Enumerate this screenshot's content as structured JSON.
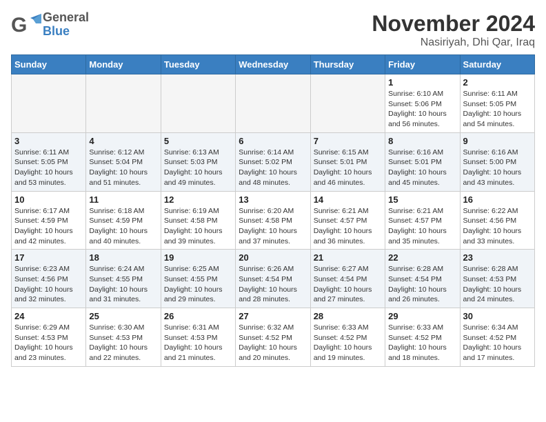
{
  "header": {
    "logo_line1": "General",
    "logo_line2": "Blue",
    "month": "November 2024",
    "location": "Nasiriyah, Dhi Qar, Iraq"
  },
  "days_of_week": [
    "Sunday",
    "Monday",
    "Tuesday",
    "Wednesday",
    "Thursday",
    "Friday",
    "Saturday"
  ],
  "weeks": [
    [
      {
        "day": "",
        "info": ""
      },
      {
        "day": "",
        "info": ""
      },
      {
        "day": "",
        "info": ""
      },
      {
        "day": "",
        "info": ""
      },
      {
        "day": "",
        "info": ""
      },
      {
        "day": "1",
        "info": "Sunrise: 6:10 AM\nSunset: 5:06 PM\nDaylight: 10 hours\nand 56 minutes."
      },
      {
        "day": "2",
        "info": "Sunrise: 6:11 AM\nSunset: 5:05 PM\nDaylight: 10 hours\nand 54 minutes."
      }
    ],
    [
      {
        "day": "3",
        "info": "Sunrise: 6:11 AM\nSunset: 5:05 PM\nDaylight: 10 hours\nand 53 minutes."
      },
      {
        "day": "4",
        "info": "Sunrise: 6:12 AM\nSunset: 5:04 PM\nDaylight: 10 hours\nand 51 minutes."
      },
      {
        "day": "5",
        "info": "Sunrise: 6:13 AM\nSunset: 5:03 PM\nDaylight: 10 hours\nand 49 minutes."
      },
      {
        "day": "6",
        "info": "Sunrise: 6:14 AM\nSunset: 5:02 PM\nDaylight: 10 hours\nand 48 minutes."
      },
      {
        "day": "7",
        "info": "Sunrise: 6:15 AM\nSunset: 5:01 PM\nDaylight: 10 hours\nand 46 minutes."
      },
      {
        "day": "8",
        "info": "Sunrise: 6:16 AM\nSunset: 5:01 PM\nDaylight: 10 hours\nand 45 minutes."
      },
      {
        "day": "9",
        "info": "Sunrise: 6:16 AM\nSunset: 5:00 PM\nDaylight: 10 hours\nand 43 minutes."
      }
    ],
    [
      {
        "day": "10",
        "info": "Sunrise: 6:17 AM\nSunset: 4:59 PM\nDaylight: 10 hours\nand 42 minutes."
      },
      {
        "day": "11",
        "info": "Sunrise: 6:18 AM\nSunset: 4:59 PM\nDaylight: 10 hours\nand 40 minutes."
      },
      {
        "day": "12",
        "info": "Sunrise: 6:19 AM\nSunset: 4:58 PM\nDaylight: 10 hours\nand 39 minutes."
      },
      {
        "day": "13",
        "info": "Sunrise: 6:20 AM\nSunset: 4:58 PM\nDaylight: 10 hours\nand 37 minutes."
      },
      {
        "day": "14",
        "info": "Sunrise: 6:21 AM\nSunset: 4:57 PM\nDaylight: 10 hours\nand 36 minutes."
      },
      {
        "day": "15",
        "info": "Sunrise: 6:21 AM\nSunset: 4:57 PM\nDaylight: 10 hours\nand 35 minutes."
      },
      {
        "day": "16",
        "info": "Sunrise: 6:22 AM\nSunset: 4:56 PM\nDaylight: 10 hours\nand 33 minutes."
      }
    ],
    [
      {
        "day": "17",
        "info": "Sunrise: 6:23 AM\nSunset: 4:56 PM\nDaylight: 10 hours\nand 32 minutes."
      },
      {
        "day": "18",
        "info": "Sunrise: 6:24 AM\nSunset: 4:55 PM\nDaylight: 10 hours\nand 31 minutes."
      },
      {
        "day": "19",
        "info": "Sunrise: 6:25 AM\nSunset: 4:55 PM\nDaylight: 10 hours\nand 29 minutes."
      },
      {
        "day": "20",
        "info": "Sunrise: 6:26 AM\nSunset: 4:54 PM\nDaylight: 10 hours\nand 28 minutes."
      },
      {
        "day": "21",
        "info": "Sunrise: 6:27 AM\nSunset: 4:54 PM\nDaylight: 10 hours\nand 27 minutes."
      },
      {
        "day": "22",
        "info": "Sunrise: 6:28 AM\nSunset: 4:54 PM\nDaylight: 10 hours\nand 26 minutes."
      },
      {
        "day": "23",
        "info": "Sunrise: 6:28 AM\nSunset: 4:53 PM\nDaylight: 10 hours\nand 24 minutes."
      }
    ],
    [
      {
        "day": "24",
        "info": "Sunrise: 6:29 AM\nSunset: 4:53 PM\nDaylight: 10 hours\nand 23 minutes."
      },
      {
        "day": "25",
        "info": "Sunrise: 6:30 AM\nSunset: 4:53 PM\nDaylight: 10 hours\nand 22 minutes."
      },
      {
        "day": "26",
        "info": "Sunrise: 6:31 AM\nSunset: 4:53 PM\nDaylight: 10 hours\nand 21 minutes."
      },
      {
        "day": "27",
        "info": "Sunrise: 6:32 AM\nSunset: 4:52 PM\nDaylight: 10 hours\nand 20 minutes."
      },
      {
        "day": "28",
        "info": "Sunrise: 6:33 AM\nSunset: 4:52 PM\nDaylight: 10 hours\nand 19 minutes."
      },
      {
        "day": "29",
        "info": "Sunrise: 6:33 AM\nSunset: 4:52 PM\nDaylight: 10 hours\nand 18 minutes."
      },
      {
        "day": "30",
        "info": "Sunrise: 6:34 AM\nSunset: 4:52 PM\nDaylight: 10 hours\nand 17 minutes."
      }
    ]
  ]
}
